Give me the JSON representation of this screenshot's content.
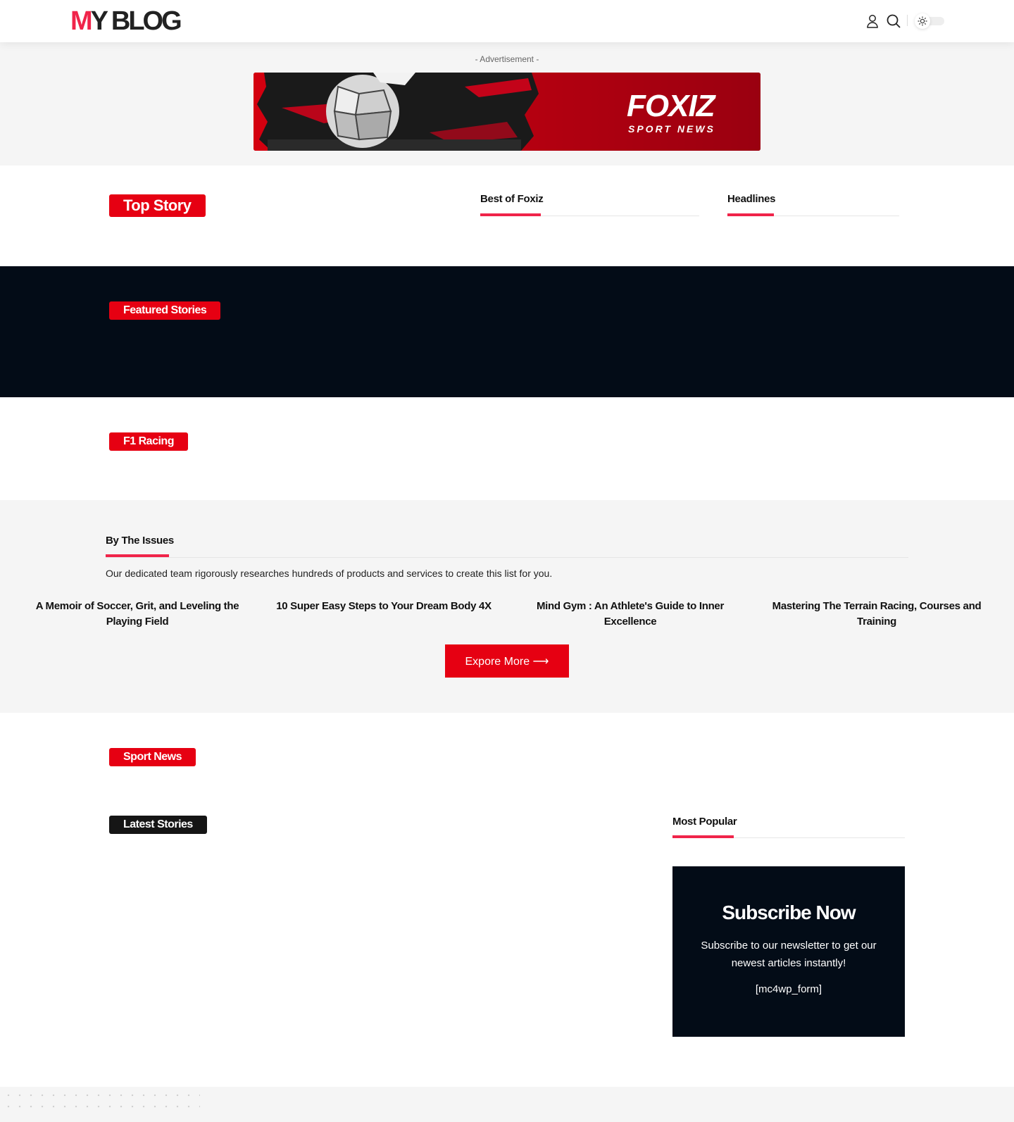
{
  "header": {
    "logo_first": "M",
    "logo_rest": "Y BLOG",
    "icons": [
      "user-icon",
      "search-icon",
      "sun-icon"
    ]
  },
  "ad": {
    "label": "- Advertisement -",
    "brand": "FOXIZ",
    "tagline": "SPORT NEWS"
  },
  "sections": {
    "top_story": "Top Story",
    "best_of": "Best of Foxiz",
    "headlines": "Headlines",
    "featured": "Featured Stories",
    "f1": "F1 Racing",
    "sport_news": "Sport News",
    "latest": "Latest Stories",
    "most_popular": "Most Popular"
  },
  "issues": {
    "heading": "By The Issues",
    "description": "Our dedicated team rigorously researches hundreds of products and services to create this list for you.",
    "items": [
      "A Memoir of Soccer, Grit, and Leveling the Playing Field",
      "10 Super Easy Steps to Your Dream Body 4X",
      "Mind Gym : An Athlete's Guide to Inner Excellence",
      "Mastering The Terrain Racing, Courses and Training"
    ],
    "button": "Expore More ⟶"
  },
  "subscribe": {
    "title": "Subscribe Now",
    "description": "Subscribe to our newsletter to get our newest articles instantly!",
    "form": "[mc4wp_form]"
  },
  "colors": {
    "accent": "#f0244a",
    "red": "#e60012",
    "dark": "#030c17",
    "gray": "#f5f5f5"
  }
}
